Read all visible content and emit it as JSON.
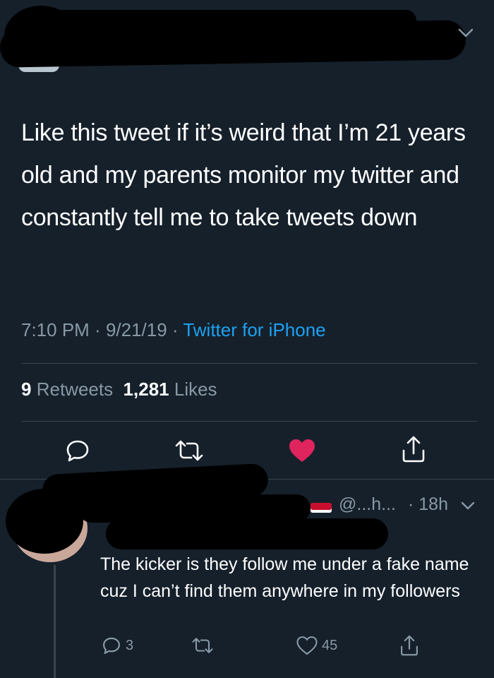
{
  "tweet": {
    "text": "Like this tweet if it’s weird that I’m 21 years old and my parents monitor my twitter and constantly tell me to take tweets down",
    "time": "7:10 PM",
    "date": "9/21/19",
    "source": "Twitter for iPhone",
    "retweets_count": "9",
    "retweets_label": "Retweets",
    "likes_count": "1,281",
    "likes_label": "Likes",
    "liked": true
  },
  "reply": {
    "handle_fragment": "@...h...",
    "age": "18h",
    "text": "The kicker is they follow me under a fake name cuz I can’t find them anywhere in my followers",
    "reply_count": "3",
    "like_count": "45"
  },
  "colors": {
    "background": "#15202b",
    "muted": "#8899a6",
    "link": "#1da1f2",
    "like": "#e0245e",
    "divider": "#38444d"
  },
  "icons": [
    "chevron-down-icon",
    "reply-icon",
    "retweet-icon",
    "heart-icon",
    "share-icon"
  ]
}
